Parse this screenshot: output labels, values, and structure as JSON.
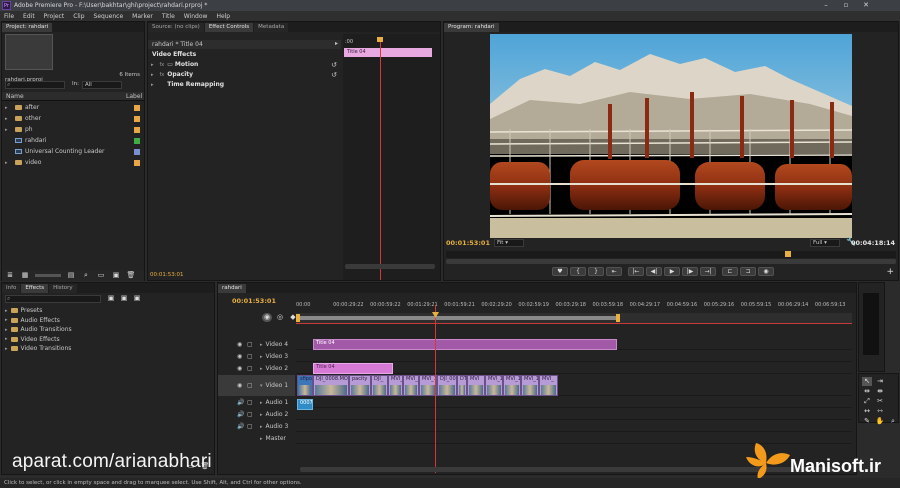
{
  "app": {
    "title": "Adobe Premiere Pro - F:\\User\\bakhtar\\ghi\\project\\rahdari.prproj *"
  },
  "menu": [
    "File",
    "Edit",
    "Project",
    "Clip",
    "Sequence",
    "Marker",
    "Title",
    "Window",
    "Help"
  ],
  "project": {
    "tab": "Project: rahdari",
    "file": "rahdari.prproj",
    "items_count": "6 Items",
    "search_in_label": "In:",
    "search_in_value": "All",
    "col_name": "Name",
    "col_label": "Label",
    "items": [
      {
        "name": "after",
        "type": "folder",
        "color": "#e8a646"
      },
      {
        "name": "other",
        "type": "folder",
        "color": "#e8a646"
      },
      {
        "name": "ph",
        "type": "folder",
        "color": "#e8a646"
      },
      {
        "name": "rahdari",
        "type": "sequence",
        "color": "#3fae45"
      },
      {
        "name": "Universal Counting Leader",
        "type": "sequence",
        "color": "#7a8ed0"
      },
      {
        "name": "video",
        "type": "folder",
        "color": "#e8a646"
      }
    ]
  },
  "source": {
    "tabs": [
      "Source: (no clips)",
      "Effect Controls",
      "Metadata"
    ],
    "active": 1,
    "clip_label": "rahdari * Title 04",
    "section": "Video Effects",
    "effects": [
      "Motion",
      "Opacity",
      "Time Remapping"
    ],
    "title_bar": "Title 04",
    "ruler_label": ":00",
    "timecode": "00:01:53:01"
  },
  "program": {
    "tab": "Program: rahdari",
    "timecode": "00:01:53:01",
    "fit": "Fit",
    "quality": "Full",
    "duration": "00:04:18:14"
  },
  "effects_panel": {
    "tabs": [
      "Info",
      "Effects",
      "History"
    ],
    "active": 1,
    "items": [
      "Presets",
      "Audio Effects",
      "Audio Transitions",
      "Video Effects",
      "Video Transitions"
    ]
  },
  "timeline": {
    "tab": "rahdari",
    "timecode": "00:01:53:01",
    "ruler": [
      "00:00",
      "00:00:29:22",
      "00:00:59:22",
      "00:01:29:21",
      "00:01:59:21",
      "00:02:29:20",
      "00:02:59:19",
      "00:03:29:18",
      "00:03:59:18",
      "00:04:29:17",
      "00:04:59:16",
      "00:05:29:16",
      "00:05:59:15",
      "00:06:29:14",
      "00:06:59:13"
    ],
    "tracks": [
      {
        "name": "Video 4",
        "kind": "video"
      },
      {
        "name": "Video 3",
        "kind": "video"
      },
      {
        "name": "Video 2",
        "kind": "video"
      },
      {
        "name": "Video 1",
        "kind": "video"
      },
      {
        "name": "Audio 1",
        "kind": "audio"
      },
      {
        "name": "Audio 2",
        "kind": "audio"
      },
      {
        "name": "Audio 3",
        "kind": "audio"
      },
      {
        "name": "Master",
        "kind": "master"
      }
    ],
    "clips": {
      "v4": "Title 04",
      "v2": "Title 04",
      "v1": [
        "sfipo",
        "DJI_0008.MOV",
        "pacity",
        "DJI_",
        "MVI_",
        "MVI_1",
        "MVI_1(",
        "DJI_00",
        "DTI",
        "MVI",
        "MVI_1",
        "MVI_1",
        "MVI_1",
        "MVI_"
      ],
      "a1": "0007"
    }
  },
  "status": {
    "text": "Click to select, or click in empty space and drag to marquee select. Use Shift, Alt, and Ctrl for other options."
  },
  "watermark": {
    "left": "aparat.com/arianabhari",
    "right": "Manisoft.ir"
  }
}
